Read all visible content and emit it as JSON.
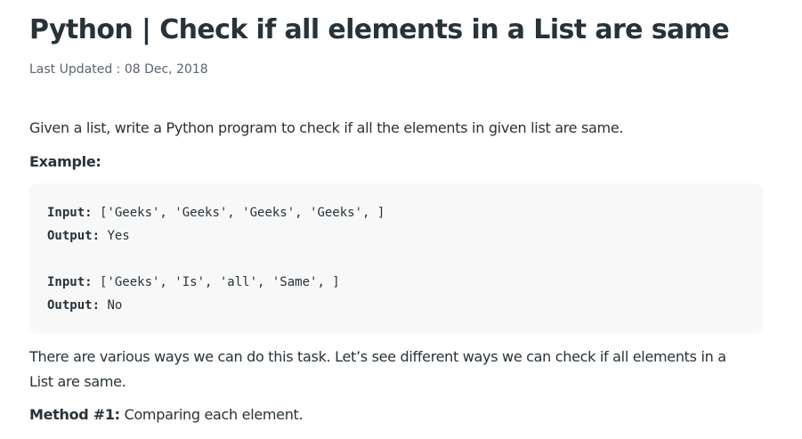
{
  "article": {
    "title": "Python | Check if all elements in a List are same",
    "last_updated": "Last Updated : 08 Dec, 2018",
    "intro": "Given a list, write a Python program to check if all the elements in given list are same.",
    "example_heading": "Example:",
    "code_block": {
      "lines": [
        {
          "key": "Input:",
          "value": " ['Geeks', 'Geeks', 'Geeks', 'Geeks', ]"
        },
        {
          "key": "Output:",
          "value": " Yes"
        },
        {
          "key": "",
          "value": ""
        },
        {
          "key": "Input:",
          "value": " ['Geeks', 'Is', 'all', 'Same', ]"
        },
        {
          "key": "Output:",
          "value": " No"
        }
      ]
    },
    "paragraph": "There are various ways we can do this task. Let’s see different ways we can check if all elements in a List are same.",
    "method": {
      "label": "Method #1:",
      "text": " Comparing each element."
    }
  }
}
